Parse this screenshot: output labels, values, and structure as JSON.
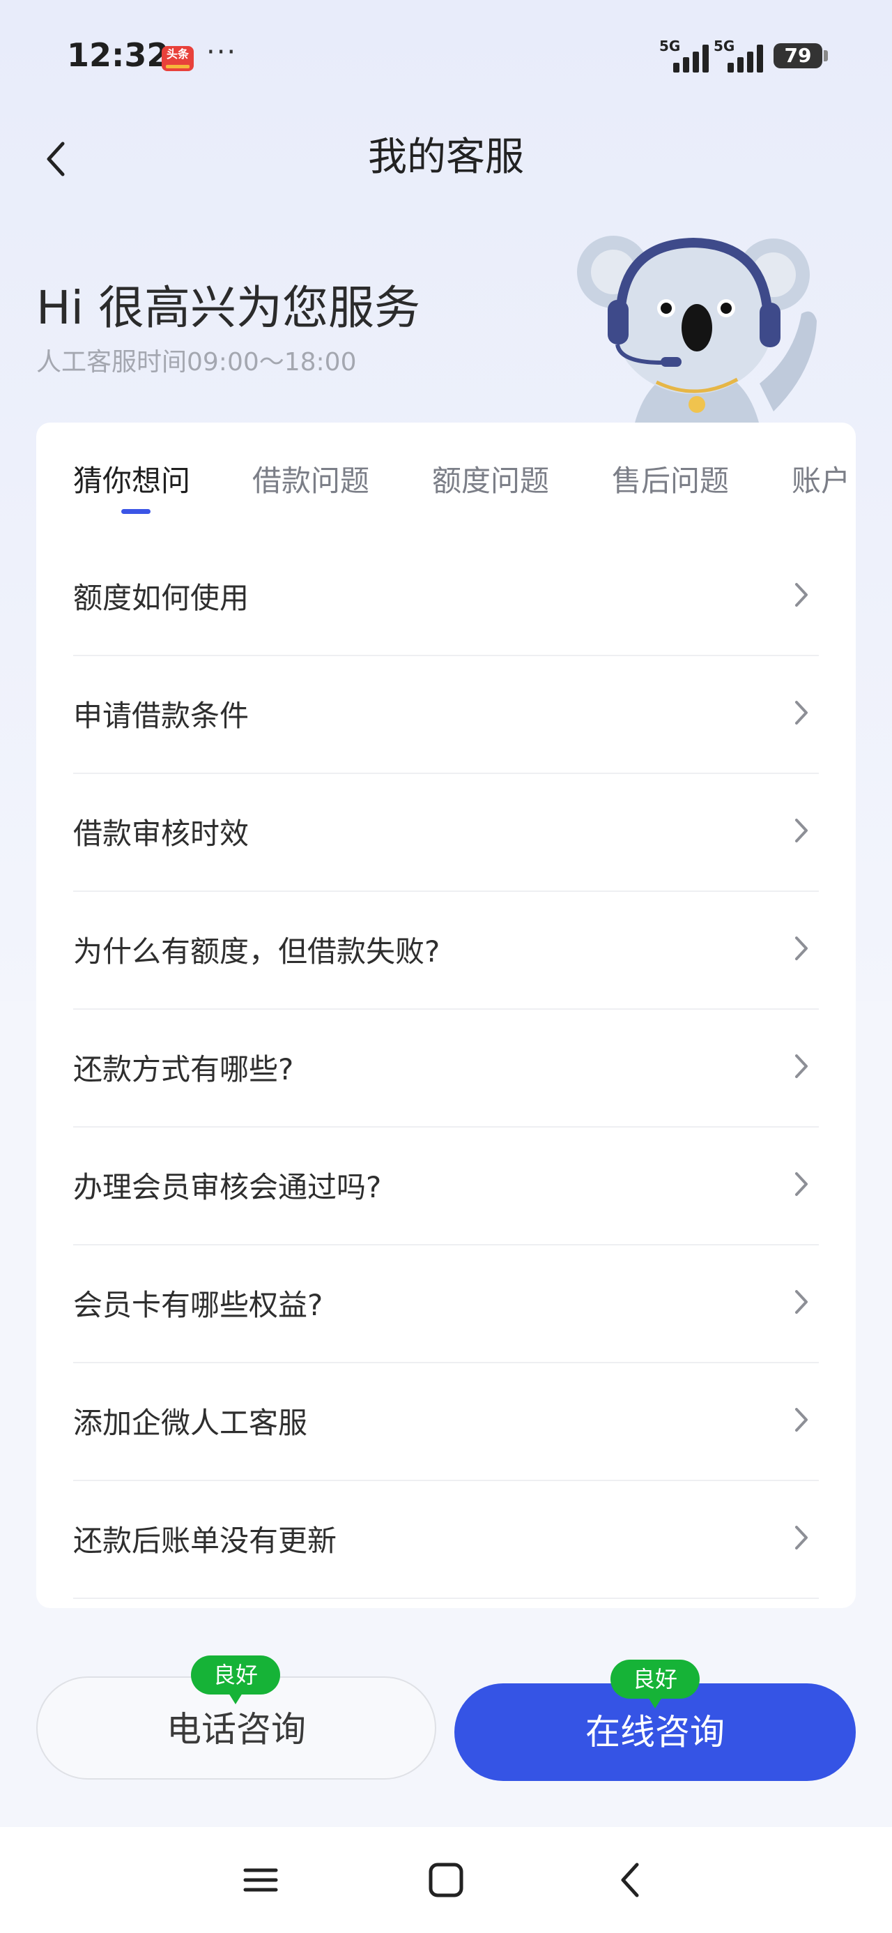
{
  "status_bar": {
    "time": "12:32",
    "news_app_label": "头条",
    "more": "···",
    "signal_1": "5G",
    "signal_2": "5G",
    "battery": "79"
  },
  "header": {
    "title": "我的客服",
    "back_icon": "chevron-left-icon"
  },
  "hero": {
    "greeting": "Hi 很高兴为您服务",
    "hours": "人工客服时间09:00～18:00"
  },
  "tabs": [
    {
      "label": "猜你想问",
      "active": true
    },
    {
      "label": "借款问题",
      "active": false
    },
    {
      "label": "额度问题",
      "active": false
    },
    {
      "label": "售后问题",
      "active": false
    },
    {
      "label": "账户",
      "active": false
    }
  ],
  "faq": [
    {
      "text": "额度如何使用"
    },
    {
      "text": "申请借款条件"
    },
    {
      "text": "借款审核时效"
    },
    {
      "text": "为什么有额度，但借款失败?"
    },
    {
      "text": "还款方式有哪些?"
    },
    {
      "text": "办理会员审核会通过吗?"
    },
    {
      "text": "会员卡有哪些权益?"
    },
    {
      "text": "添加企微人工客服"
    },
    {
      "text": "还款后账单没有更新"
    }
  ],
  "actions": {
    "phone": {
      "label": "电话咨询",
      "badge": "良好"
    },
    "online": {
      "label": "在线咨询",
      "badge": "良好"
    }
  },
  "colors": {
    "accent": "#3554e5",
    "badge": "#16b337"
  },
  "nav": {
    "menu_icon": "menu-icon",
    "home_icon": "home-square-icon",
    "back_icon": "back-chevron-icon"
  }
}
